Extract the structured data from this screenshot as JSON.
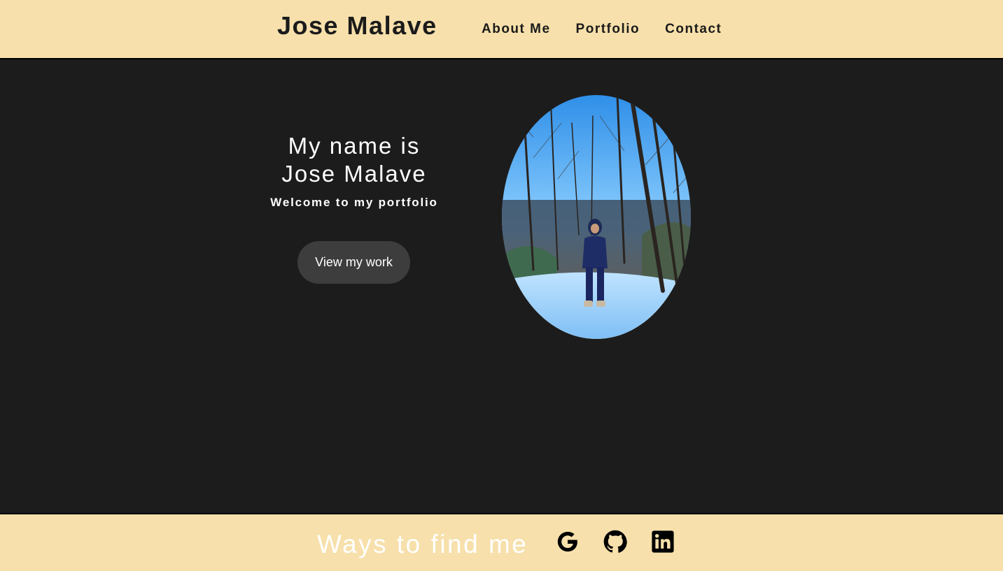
{
  "header": {
    "brand": "Jose Malave",
    "nav": [
      "About Me",
      "Portfolio",
      "Contact"
    ]
  },
  "hero": {
    "heading": "My name is Jose Malave",
    "subheading": "Welcome to my portfolio",
    "button_label": "View my work",
    "photo_icon": "profile-photo"
  },
  "footer": {
    "title": "Ways to find me",
    "links": [
      {
        "icon": "google-icon"
      },
      {
        "icon": "github-icon"
      },
      {
        "icon": "linkedin-icon"
      }
    ]
  },
  "colors": {
    "header_bg": "#f7e0ab",
    "hero_bg": "#1c1c1c",
    "button_bg": "#3d3d3d",
    "text_dark": "#1b1b1b",
    "text_light": "#ffffff"
  }
}
